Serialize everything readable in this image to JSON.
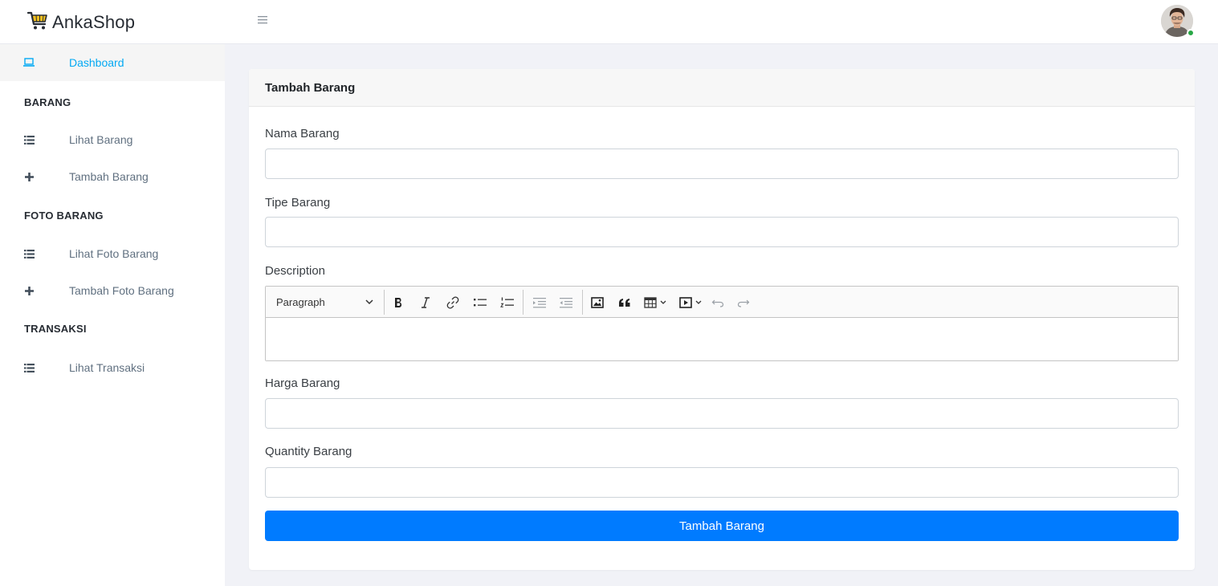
{
  "app": {
    "brand": "AnkaShop"
  },
  "sidebar": {
    "items": [
      {
        "label": "Dashboard",
        "icon": "laptop-icon",
        "active": true
      },
      {
        "title": "BARANG"
      },
      {
        "label": "Lihat Barang",
        "icon": "list-icon"
      },
      {
        "label": "Tambah Barang",
        "icon": "plus-icon"
      },
      {
        "title": "FOTO BARANG"
      },
      {
        "label": "Lihat Foto Barang",
        "icon": "list-icon"
      },
      {
        "label": "Tambah Foto Barang",
        "icon": "plus-icon"
      },
      {
        "title": "TRANSAKSI"
      },
      {
        "label": "Lihat Transaksi",
        "icon": "list-icon"
      }
    ]
  },
  "form": {
    "title": "Tambah Barang",
    "fields": [
      {
        "label": "Nama Barang",
        "value": "",
        "placeholder": ""
      },
      {
        "label": "Tipe Barang",
        "value": "",
        "placeholder": ""
      },
      {
        "label": "Description"
      },
      {
        "label": "Harga Barang",
        "value": "",
        "placeholder": ""
      },
      {
        "label": "Quantity Barang",
        "value": "",
        "placeholder": ""
      }
    ],
    "editor": {
      "heading_select": "Paragraph",
      "toolbar_icons": [
        "bold-icon",
        "italic-icon",
        "link-icon",
        "bulleted-list-icon",
        "numbered-list-icon",
        "outdent-icon",
        "indent-icon",
        "image-icon",
        "quote-icon",
        "table-icon",
        "media-icon",
        "undo-icon",
        "redo-icon"
      ]
    },
    "submit_label": "Tambah Barang"
  },
  "colors": {
    "accent": "#03a9f3",
    "primary_button": "#007bff",
    "online": "#28a745",
    "background": "#f1f2f7"
  }
}
